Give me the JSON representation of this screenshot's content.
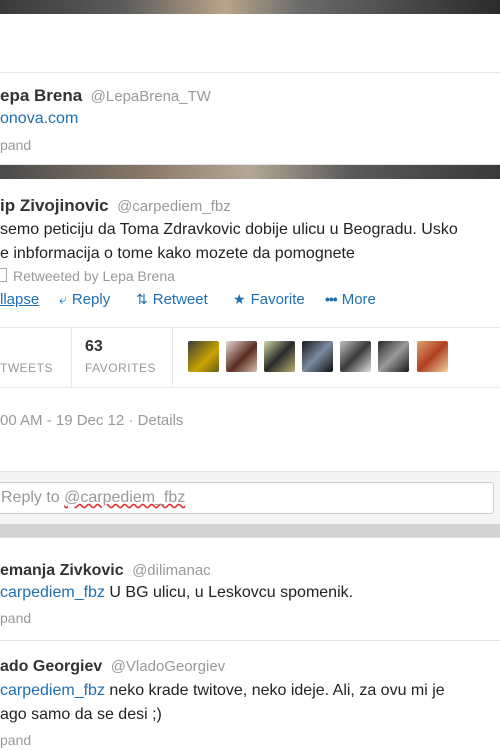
{
  "tweet1": {
    "name": "epa Brena",
    "handle": "@LepaBrena_TW",
    "link": "onova.com",
    "expand": "pand"
  },
  "tweet2": {
    "name": "ip Zivojinovic",
    "handle": "@carpediem_fbz",
    "line1": "semo peticiju da Toma Zdravkovic dobije ulicu u Beogradu. Usko",
    "line2": "e inbformacija o tome kako mozete da pomognete",
    "retweeted_by": "Retweeted by Lepa Brena",
    "actions": {
      "collapse": "llapse",
      "reply": "Reply",
      "retweet": "Retweet",
      "favorite": "Favorite",
      "more": "More"
    },
    "stats": {
      "retweets_label": "TWEETS",
      "favorites_count": "63",
      "favorites_label": "FAVORITES"
    },
    "timestamp": "00 AM - 19 Dec 12",
    "details": "Details"
  },
  "reply_box": {
    "prefix": "Reply to ",
    "mention": "@carpediem_fbz"
  },
  "reply1": {
    "name": "emanja Zivkovic",
    "handle": "@dilimanac",
    "mention": "carpediem_fbz",
    "text": " U BG ulicu, u Leskovcu spomenik.",
    "expand": "pand"
  },
  "reply2": {
    "name": "ado Georgiev",
    "handle": "@VladoGeorgiev",
    "mention": "carpediem_fbz",
    "line1": " neko krade twitove, neko ideje. Ali, za ovu mi je",
    "line2": "ago samo da se desi ;)",
    "expand": "pand"
  },
  "colors": {
    "link": "#1f6fb3",
    "muted": "#999999",
    "text": "#222222",
    "background": "#d3d3d3"
  },
  "icons": {
    "reply": "reply-arrow-icon",
    "retweet": "retweet-icon",
    "favorite": "star-icon",
    "more": "more-dots-icon"
  }
}
